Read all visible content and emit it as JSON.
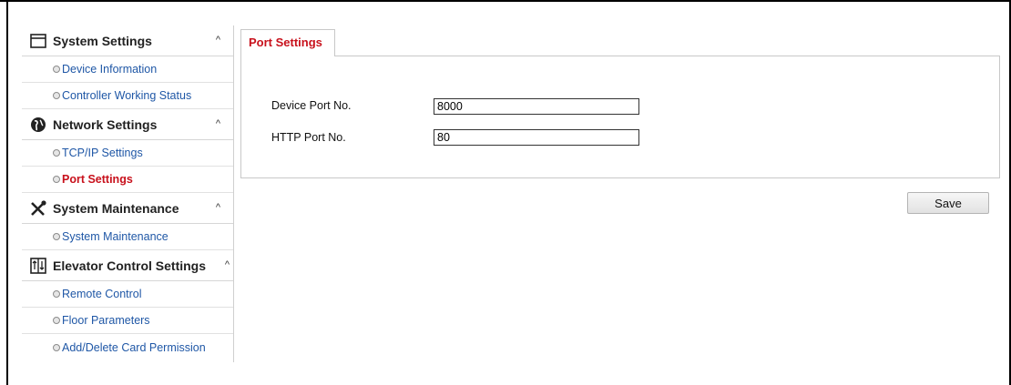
{
  "sidebar": {
    "sections": [
      {
        "title": "System Settings",
        "icon": "window-icon",
        "caret": "^",
        "items": [
          {
            "label": "Device Information"
          },
          {
            "label": "Controller Working Status"
          }
        ]
      },
      {
        "title": "Network Settings",
        "icon": "globe-icon",
        "caret": "^",
        "items": [
          {
            "label": "TCP/IP Settings"
          },
          {
            "label": "Port Settings"
          }
        ]
      },
      {
        "title": "System Maintenance",
        "icon": "tools-icon",
        "caret": "^",
        "items": [
          {
            "label": "System Maintenance"
          }
        ]
      },
      {
        "title": "Elevator Control Settings",
        "icon": "elevator-icon",
        "caret": "^",
        "items": [
          {
            "label": "Remote Control"
          },
          {
            "label": "Floor Parameters"
          },
          {
            "label": "Add/Delete Card Permission"
          }
        ]
      }
    ]
  },
  "main": {
    "tab": "Port Settings",
    "fields": [
      {
        "label": "Device Port No.",
        "value": "8000"
      },
      {
        "label": "HTTP Port No.",
        "value": "80"
      }
    ],
    "save_label": "Save"
  },
  "colors": {
    "active": "#c8111c",
    "link": "#1f57a6"
  }
}
